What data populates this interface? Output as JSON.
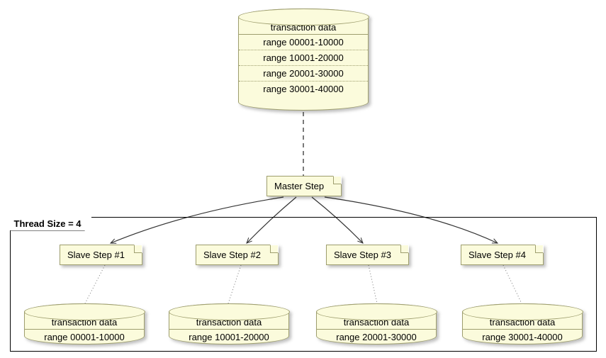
{
  "chart_data": {
    "type": "diagram",
    "master_db": {
      "title": "transaction data",
      "partitions": [
        "range 00001-10000",
        "range 10001-20000",
        "range 20001-30000",
        "range 30001-40000"
      ]
    },
    "master_step": "Master Step",
    "frame_label": "Thread Size = 4",
    "slaves": [
      {
        "step": "Slave Step #1",
        "db_title": "transaction data",
        "db_range": "range 00001-10000"
      },
      {
        "step": "Slave Step #2",
        "db_title": "transaction data",
        "db_range": "range 10001-20000"
      },
      {
        "step": "Slave Step #3",
        "db_title": "transaction data",
        "db_range": "range 20001-30000"
      },
      {
        "step": "Slave Step #4",
        "db_title": "transaction data",
        "db_range": "range 30001-40000"
      }
    ]
  }
}
